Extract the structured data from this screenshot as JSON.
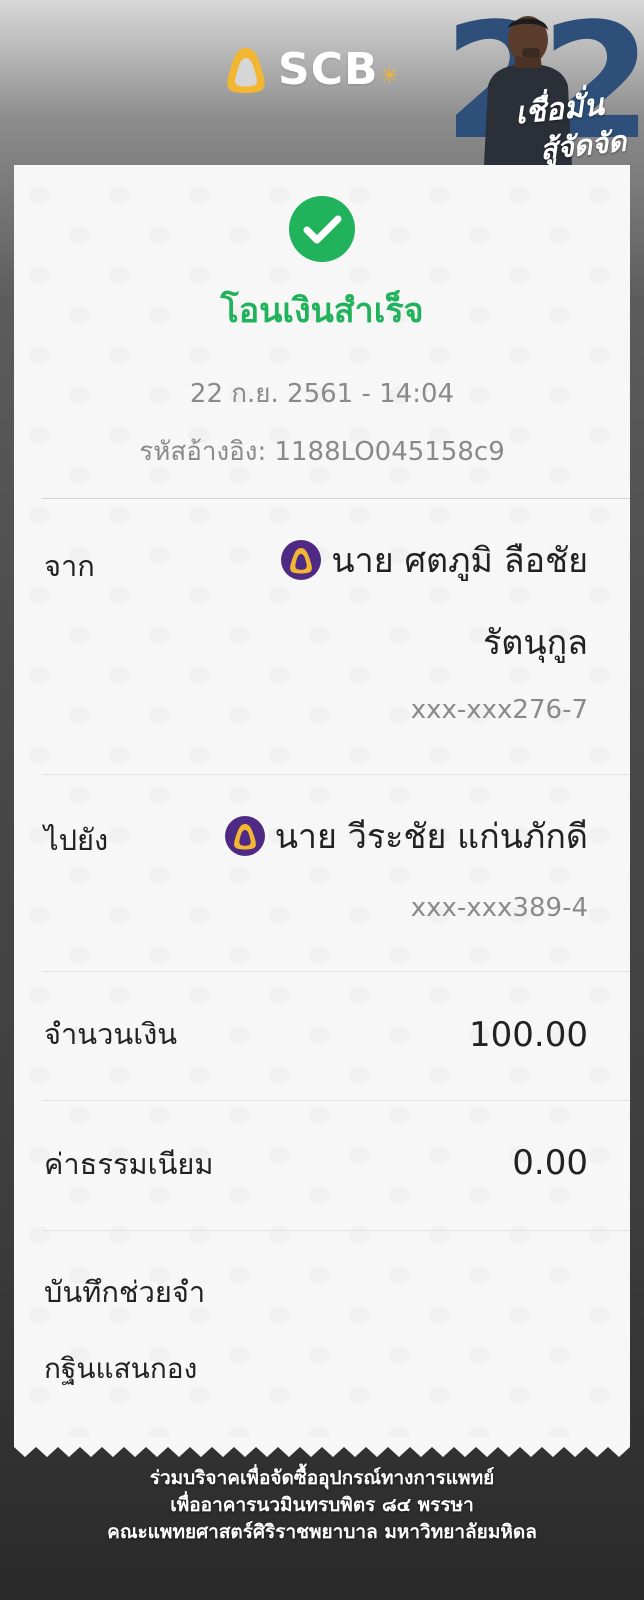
{
  "header": {
    "brand": "SCB",
    "promo_number": "22",
    "promo_text_1": "เชื่อมั่น",
    "promo_text_2": "สู้จัดจัด"
  },
  "receipt": {
    "status": "โอนเงินสำเร็จ",
    "datetime": "22 ก.ย. 2561 - 14:04",
    "reference": "รหัสอ้างอิง: 1188LO045158c9",
    "from": {
      "label": "จาก",
      "name_line1": "นาย ศตภูมิ ลือชัย",
      "name_line2": "รัตนุกูล",
      "account": "xxx-xxx276-7"
    },
    "to": {
      "label": "ไปยัง",
      "name": "นาย วีระชัย แก่นภักดี",
      "account": "xxx-xxx389-4"
    },
    "amount": {
      "label": "จำนวนเงิน",
      "value": "100.00"
    },
    "fee": {
      "label": "ค่าธรรมเนียม",
      "value": "0.00"
    },
    "memo": {
      "label": "บันทึกช่วยจำ",
      "value": "กฐินแสนกอง"
    }
  },
  "footer": {
    "line1": "ร่วมบริจาคเพื่อจัดซื้ออุปกรณ์ทางการแพทย์",
    "line2": "เพื่ออาคารนวมินทรบพิตร ๘๔ พรรษา",
    "line3": "คณะแพทยศาสตร์ศิริราชพยาบาล มหาวิทยาลัยมหิดล"
  },
  "colors": {
    "success_green": "#21b25c",
    "brand_purple": "#4e2a84",
    "brand_gold": "#f2b632",
    "muted_text": "#8a8a8a"
  },
  "icons": {
    "status": "check-circle-icon",
    "bank": "scb-bank-icon",
    "brand": "scb-logo-icon"
  }
}
